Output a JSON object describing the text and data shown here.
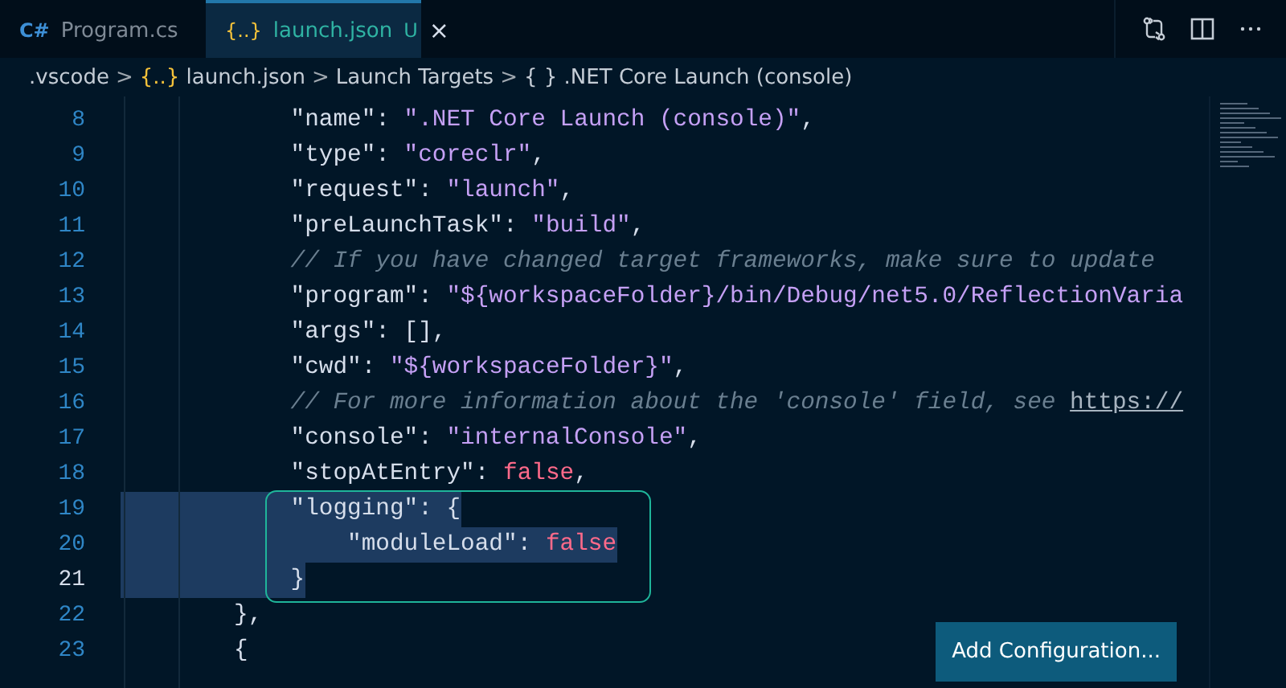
{
  "tabs": [
    {
      "icon": "C#",
      "label": "Program.cs",
      "selected": false
    },
    {
      "icon": "{..}",
      "label": "launch.json",
      "badge": "U",
      "close": "×",
      "selected": true
    }
  ],
  "breadcrumb": [
    {
      "kind": "text",
      "label": ".vscode"
    },
    {
      "kind": "sep",
      "label": ">"
    },
    {
      "kind": "json",
      "icon": "{..}",
      "label": "launch.json"
    },
    {
      "kind": "sep",
      "label": ">"
    },
    {
      "kind": "text",
      "label": "Launch Targets"
    },
    {
      "kind": "sep",
      "label": ">"
    },
    {
      "kind": "object",
      "icon": "{ }",
      "label": ".NET Core Launch (console)"
    }
  ],
  "lines": [
    {
      "number": "8",
      "kind": "entry",
      "selected": false,
      "current": false,
      "tokens": [
        {
          "kind": "key",
          "text": "\"name\""
        },
        {
          "kind": "punct",
          "text": ": "
        },
        {
          "kind": "string",
          "text": "\".NET Core Launch (console)\""
        },
        {
          "kind": "punct",
          "text": ","
        }
      ]
    },
    {
      "number": "9",
      "kind": "entry",
      "selected": false,
      "current": false,
      "tokens": [
        {
          "kind": "key",
          "text": "\"type\""
        },
        {
          "kind": "punct",
          "text": ": "
        },
        {
          "kind": "string",
          "text": "\"coreclr\""
        },
        {
          "kind": "punct",
          "text": ","
        }
      ]
    },
    {
      "number": "10",
      "kind": "entry",
      "selected": false,
      "current": false,
      "tokens": [
        {
          "kind": "key",
          "text": "\"request\""
        },
        {
          "kind": "punct",
          "text": ": "
        },
        {
          "kind": "string",
          "text": "\"launch\""
        },
        {
          "kind": "punct",
          "text": ","
        }
      ]
    },
    {
      "number": "11",
      "kind": "entry",
      "selected": false,
      "current": false,
      "tokens": [
        {
          "kind": "key",
          "text": "\"preLaunchTask\""
        },
        {
          "kind": "punct",
          "text": ": "
        },
        {
          "kind": "string",
          "text": "\"build\""
        },
        {
          "kind": "punct",
          "text": ","
        }
      ]
    },
    {
      "number": "12",
      "kind": "entry",
      "selected": false,
      "current": false,
      "tokens": [
        {
          "kind": "comment",
          "text": "// If you have changed target frameworks, make sure to update"
        }
      ]
    },
    {
      "number": "13",
      "kind": "entry",
      "selected": false,
      "current": false,
      "tokens": [
        {
          "kind": "key",
          "text": "\"program\""
        },
        {
          "kind": "punct",
          "text": ": "
        },
        {
          "kind": "string",
          "text": "\"${workspaceFolder}/bin/Debug/net5.0/ReflectionVaria"
        }
      ]
    },
    {
      "number": "14",
      "kind": "entry",
      "selected": false,
      "current": false,
      "tokens": [
        {
          "kind": "key",
          "text": "\"args\""
        },
        {
          "kind": "punct",
          "text": ": [],"
        }
      ]
    },
    {
      "number": "15",
      "kind": "entry",
      "selected": false,
      "current": false,
      "tokens": [
        {
          "kind": "key",
          "text": "\"cwd\""
        },
        {
          "kind": "punct",
          "text": ": "
        },
        {
          "kind": "string",
          "text": "\"${workspaceFolder}\""
        },
        {
          "kind": "punct",
          "text": ","
        }
      ]
    },
    {
      "number": "16",
      "kind": "entry",
      "selected": false,
      "current": false,
      "tokens": [
        {
          "kind": "comment",
          "text": "// For more information about the 'console' field, see "
        },
        {
          "kind": "link",
          "text": "https://"
        }
      ]
    },
    {
      "number": "17",
      "kind": "entry",
      "selected": false,
      "current": false,
      "tokens": [
        {
          "kind": "key",
          "text": "\"console\""
        },
        {
          "kind": "punct",
          "text": ": "
        },
        {
          "kind": "string",
          "text": "\"internalConsole\""
        },
        {
          "kind": "punct",
          "text": ","
        }
      ]
    },
    {
      "number": "18",
      "kind": "entry",
      "selected": false,
      "current": false,
      "tokens": [
        {
          "kind": "key",
          "text": "\"stopAtEntry\""
        },
        {
          "kind": "punct",
          "text": ": "
        },
        {
          "kind": "keyword",
          "text": "false"
        },
        {
          "kind": "punct",
          "text": ","
        }
      ]
    },
    {
      "number": "19",
      "kind": "entry",
      "selected": true,
      "current": false,
      "tokens": [
        {
          "kind": "key",
          "text": "\"logging\""
        },
        {
          "kind": "punct",
          "text": ": {"
        }
      ]
    },
    {
      "number": "20",
      "kind": "inner",
      "selected": true,
      "current": false,
      "tokens": [
        {
          "kind": "key",
          "text": "\"moduleLoad\""
        },
        {
          "kind": "punct",
          "text": ": "
        },
        {
          "kind": "keyword",
          "text": "false"
        }
      ]
    },
    {
      "number": "21",
      "kind": "entry",
      "selected": true,
      "current": true,
      "tokens": [
        {
          "kind": "punct",
          "text": "}"
        }
      ]
    },
    {
      "number": "22",
      "kind": "outer",
      "selected": false,
      "current": false,
      "tokens": [
        {
          "kind": "punct",
          "text": "},"
        }
      ]
    },
    {
      "number": "23",
      "kind": "outer",
      "selected": false,
      "current": false,
      "tokens": [
        {
          "kind": "punct",
          "text": "{"
        }
      ]
    }
  ],
  "add_button": "Add Configuration..."
}
